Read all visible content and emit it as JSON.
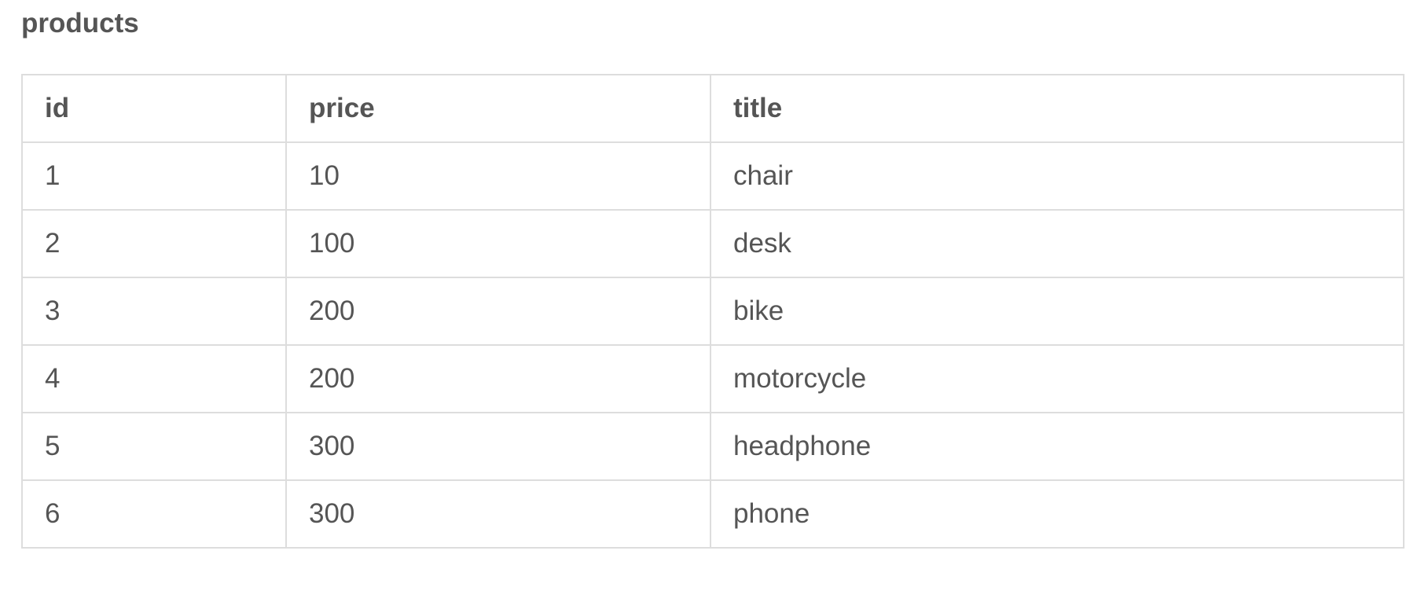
{
  "table": {
    "name": "products",
    "columns": [
      "id",
      "price",
      "title"
    ],
    "rows": [
      [
        "1",
        "10",
        "chair"
      ],
      [
        "2",
        "100",
        "desk"
      ],
      [
        "3",
        "200",
        "bike"
      ],
      [
        "4",
        "200",
        "motorcycle"
      ],
      [
        "5",
        "300",
        "headphone"
      ],
      [
        "6",
        "300",
        "phone"
      ]
    ]
  }
}
